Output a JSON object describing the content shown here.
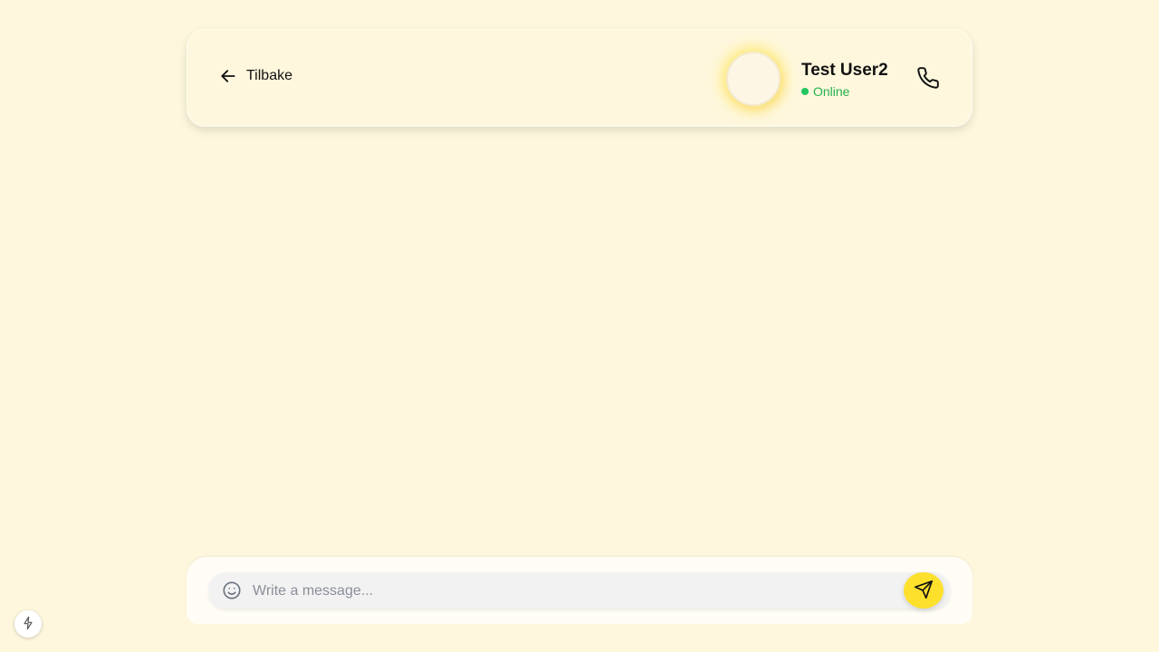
{
  "header": {
    "back_label": "Tilbake",
    "back_icon": "arrow-left-icon",
    "call_icon": "phone-icon"
  },
  "contact": {
    "name": "Test User2",
    "status": "Online",
    "status_color": "#22c55e"
  },
  "composer": {
    "placeholder": "Write a message...",
    "value": "",
    "emoji_icon": "smiley-icon",
    "send_icon": "send-icon",
    "send_color": "#fde02c"
  },
  "devtools": {
    "icon": "lightning-icon"
  },
  "theme": {
    "background": "#fef7dd"
  }
}
